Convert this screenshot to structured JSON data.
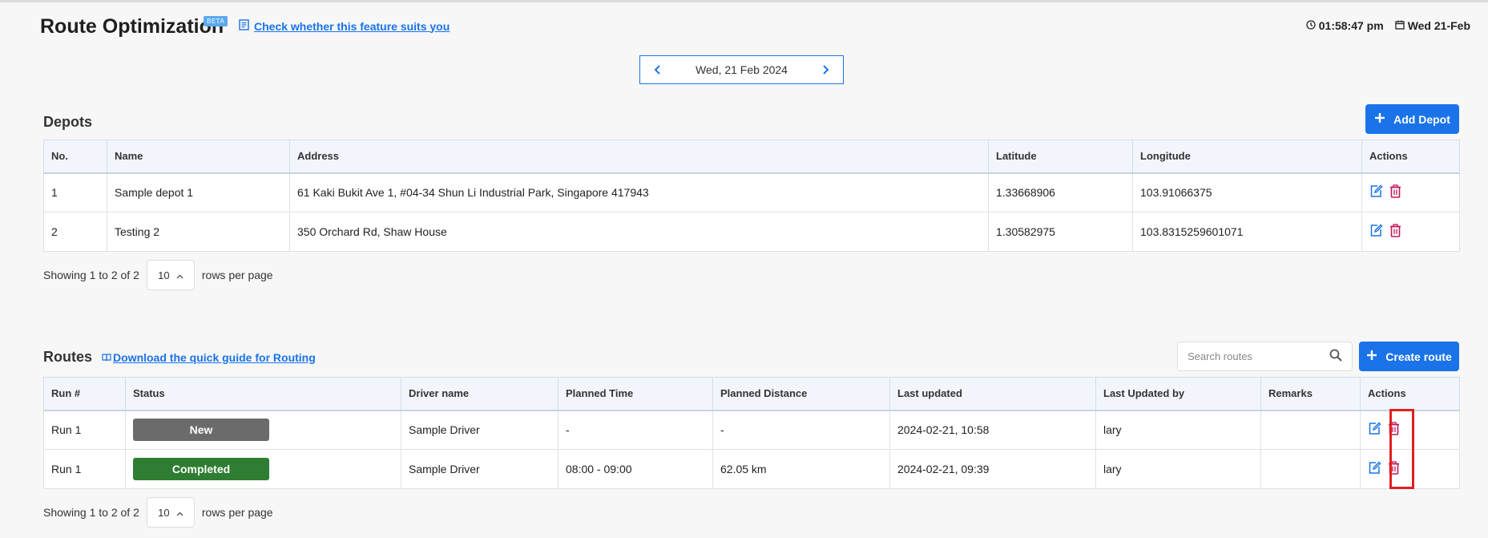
{
  "header": {
    "title": "Route Optimization",
    "beta": "BETA",
    "feature_link": "Check whether this feature suits you",
    "time": "01:58:47 pm",
    "date": "Wed 21-Feb"
  },
  "date_nav": {
    "label": "Wed, 21 Feb 2024"
  },
  "depots": {
    "title": "Depots",
    "add_button": "Add Depot",
    "columns": [
      "No.",
      "Name",
      "Address",
      "Latitude",
      "Longitude",
      "Actions"
    ],
    "rows": [
      {
        "no": "1",
        "name": "Sample depot 1",
        "address": "61 Kaki Bukit Ave 1, #04-34 Shun Li Industrial Park, Singapore 417943",
        "latitude": "1.33668906",
        "longitude": "103.91066375"
      },
      {
        "no": "2",
        "name": "Testing 2",
        "address": "350 Orchard Rd, Shaw House",
        "latitude": "1.30582975",
        "longitude": "103.8315259601071"
      }
    ],
    "pager": {
      "showing": "Showing 1 to 2 of 2",
      "rows_value": "10",
      "rows_label": "rows per page"
    }
  },
  "routes": {
    "title": "Routes",
    "guide_link": "Download the quick guide for Routing",
    "search_placeholder": "Search routes",
    "create_button": "Create route",
    "columns": [
      "Run #",
      "Status",
      "Driver name",
      "Planned Time",
      "Planned Distance",
      "Last updated",
      "Last Updated by",
      "Remarks",
      "Actions"
    ],
    "rows": [
      {
        "run": "Run 1",
        "status": "New",
        "status_color": "#6b6b6b",
        "driver": "Sample Driver",
        "time": "-",
        "distance": "-",
        "updated": "2024-02-21, 10:58",
        "updated_by": "lary",
        "remarks": ""
      },
      {
        "run": "Run 1",
        "status": "Completed",
        "status_color": "#2e7d32",
        "driver": "Sample Driver",
        "time": "08:00 - 09:00",
        "distance": "62.05 km",
        "updated": "2024-02-21, 09:39",
        "updated_by": "lary",
        "remarks": ""
      }
    ],
    "pager": {
      "showing": "Showing 1 to 2 of 2",
      "rows_value": "10",
      "rows_label": "rows per page"
    }
  },
  "colors": {
    "accent": "#1a73e8",
    "delete": "#c2185b",
    "highlight": "#e02020"
  }
}
